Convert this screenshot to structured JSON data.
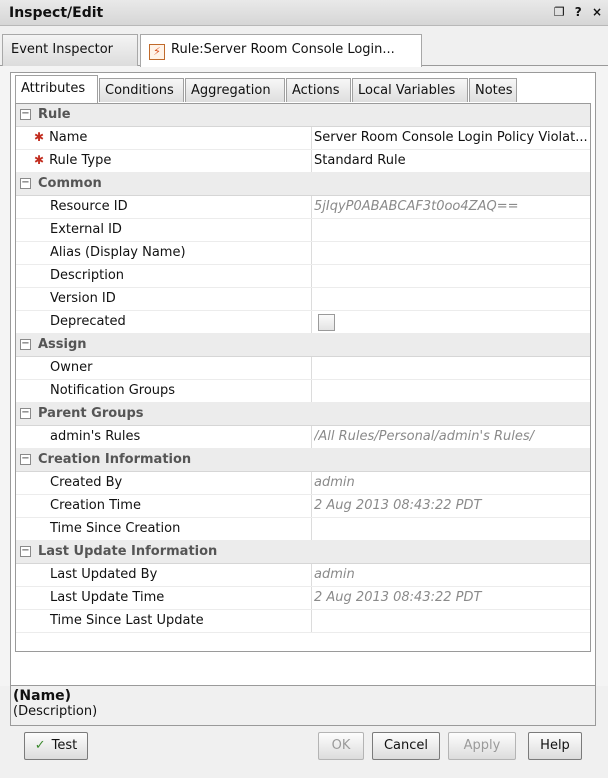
{
  "window": {
    "title": "Inspect/Edit",
    "controls": [
      "❐",
      "?",
      "×"
    ]
  },
  "doc_tabs": [
    {
      "label": "Event Inspector"
    },
    {
      "label": "Rule:Server Room Console Login...",
      "icon": "rule-flash-icon"
    }
  ],
  "sub_tabs": [
    "Attributes",
    "Conditions",
    "Aggregation",
    "Actions",
    "Local Variables",
    "Notes"
  ],
  "sections": {
    "rule": {
      "title": "Rule",
      "name_label": "Name",
      "name_value": "Server Room Console Login Policy Violat...",
      "type_label": "Rule Type",
      "type_value": "Standard Rule"
    },
    "common": {
      "title": "Common",
      "resource_label": "Resource ID",
      "resource_value": "5jIqyP0ABABCAF3t0oo4ZAQ==",
      "external_label": "External ID",
      "alias_label": "Alias (Display Name)",
      "description_label": "Description",
      "version_label": "Version ID",
      "deprecated_label": "Deprecated"
    },
    "assign": {
      "title": "Assign",
      "owner_label": "Owner",
      "notification_label": "Notification Groups"
    },
    "parent_groups": {
      "title": "Parent Groups",
      "group_label": "admin's Rules",
      "group_value": "/All Rules/Personal/admin's Rules/"
    },
    "creation": {
      "title": "Creation Information",
      "created_by_label": "Created By",
      "created_by_value": "admin",
      "creation_time_label": "Creation Time",
      "creation_time_value": "2 Aug 2013 08:43:22 PDT",
      "since_label": "Time Since Creation"
    },
    "update": {
      "title": "Last Update Information",
      "updated_by_label": "Last Updated By",
      "updated_by_value": "admin",
      "update_time_label": "Last Update Time",
      "update_time_value": "2 Aug 2013 08:43:22 PDT",
      "since_label": "Time Since Last Update"
    }
  },
  "footer": {
    "name": "(Name)",
    "description": "(Description)",
    "buttons": {
      "test": "Test",
      "ok": "OK",
      "cancel": "Cancel",
      "apply": "Apply",
      "help": "Help"
    }
  },
  "colors": {
    "required_mark": "#c22d1f",
    "section_bg": "#ececec",
    "gray_value": "#8a8a8a",
    "test_check": "#3d8a2f"
  }
}
